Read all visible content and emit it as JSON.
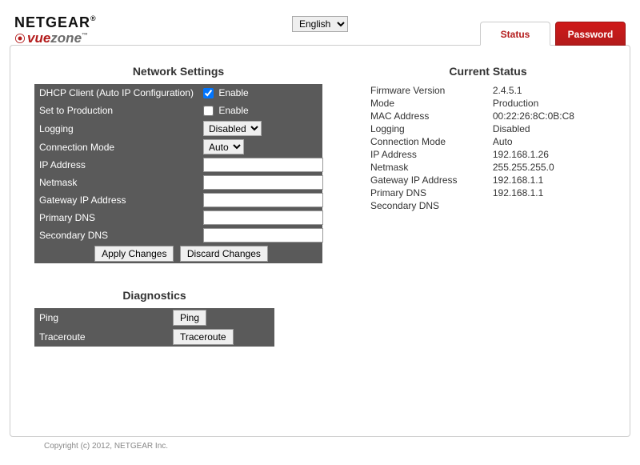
{
  "logo": {
    "brand": "NETGEAR",
    "subbrand_vue": "vue",
    "subbrand_zone": "zone"
  },
  "language": {
    "selected": "English"
  },
  "tabs": {
    "status": "Status",
    "password": "Password"
  },
  "network_settings": {
    "heading": "Network Settings",
    "fields": {
      "dhcp_label": "DHCP Client (Auto IP Configuration)",
      "dhcp_enable_text": "Enable",
      "dhcp_checked": true,
      "setprod_label": "Set to Production",
      "setprod_enable_text": "Enable",
      "setprod_checked": false,
      "logging_label": "Logging",
      "logging_selected": "Disabled",
      "connmode_label": "Connection Mode",
      "connmode_selected": "Auto",
      "ip_label": "IP Address",
      "ip_value": "",
      "netmask_label": "Netmask",
      "netmask_value": "",
      "gateway_label": "Gateway IP Address",
      "gateway_value": "",
      "pdns_label": "Primary DNS",
      "pdns_value": "",
      "sdns_label": "Secondary DNS",
      "sdns_value": ""
    },
    "buttons": {
      "apply": "Apply Changes",
      "discard": "Discard Changes"
    }
  },
  "diagnostics": {
    "heading": "Diagnostics",
    "ping_label": "Ping",
    "ping_button": "Ping",
    "tracer_label": "Traceroute",
    "tracer_button": "Traceroute"
  },
  "current_status": {
    "heading": "Current Status",
    "rows": [
      {
        "label": "Firmware Version",
        "value": "2.4.5.1"
      },
      {
        "label": "Mode",
        "value": "Production"
      },
      {
        "label": "MAC Address",
        "value": "00:22:26:8C:0B:C8"
      },
      {
        "label": "Logging",
        "value": "Disabled"
      },
      {
        "label": "Connection Mode",
        "value": "Auto"
      },
      {
        "label": "IP Address",
        "value": "192.168.1.26"
      },
      {
        "label": "Netmask",
        "value": "255.255.255.0"
      },
      {
        "label": "Gateway IP Address",
        "value": "192.168.1.1"
      },
      {
        "label": "Primary DNS",
        "value": "192.168.1.1"
      },
      {
        "label": "Secondary DNS",
        "value": ""
      }
    ]
  },
  "footer": "Copyright (c) 2012, NETGEAR Inc."
}
